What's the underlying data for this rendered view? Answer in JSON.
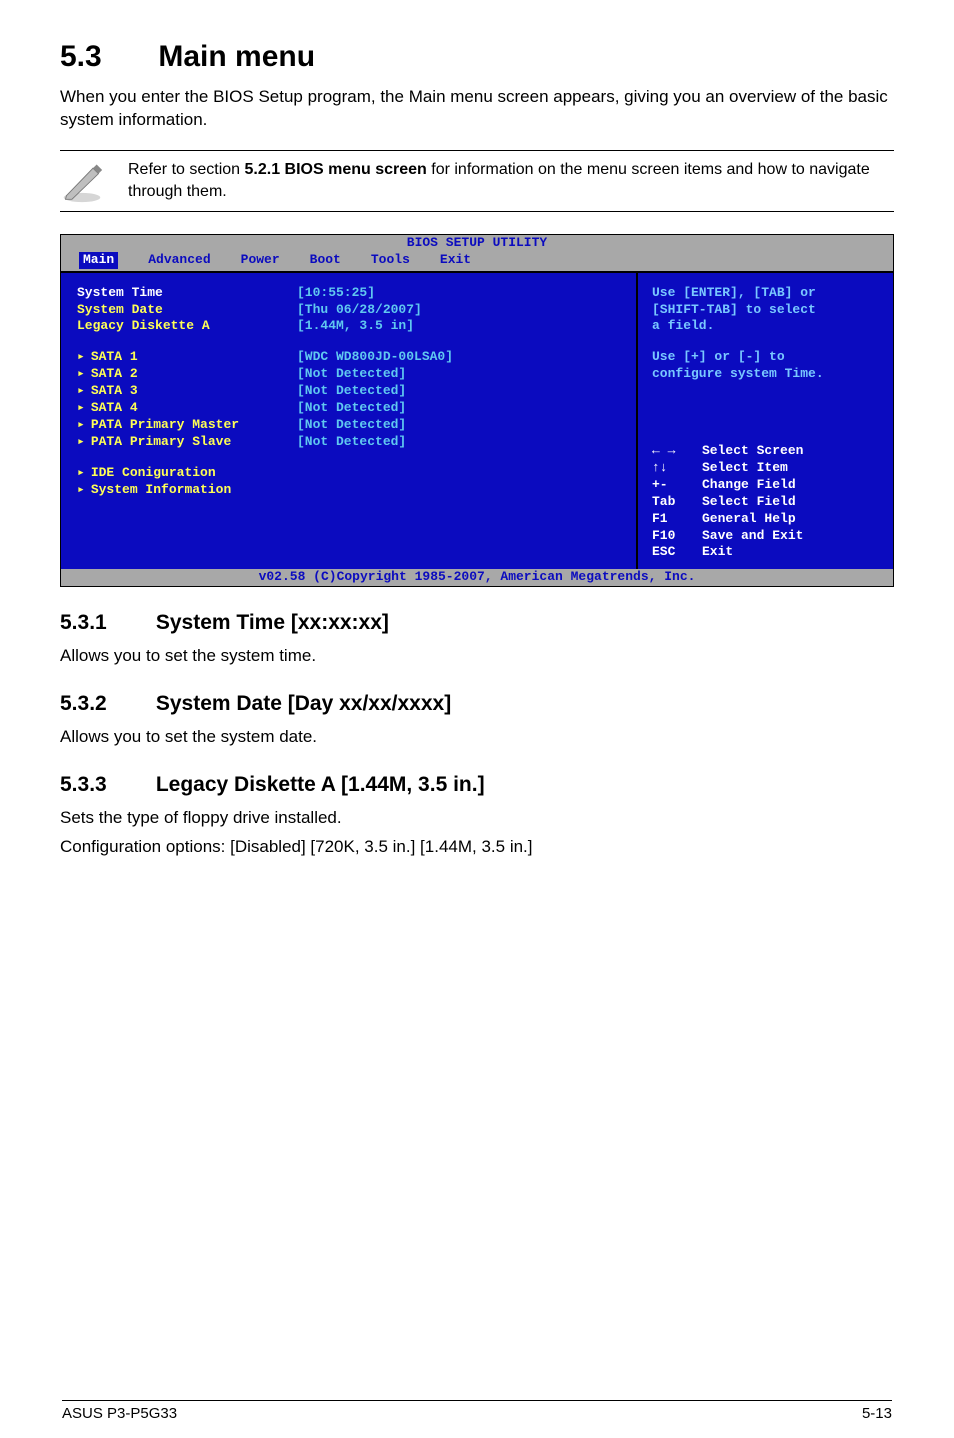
{
  "heading": {
    "num": "5.3",
    "title": "Main menu"
  },
  "intro": "When you enter the BIOS Setup program, the Main menu screen appears, giving you an overview of the basic system information.",
  "note": {
    "pre": "Refer to section ",
    "bold": "5.2.1 BIOS menu screen",
    "post": " for information on the menu screen items and how to navigate through them."
  },
  "bios": {
    "title": "BIOS SETUP UTILITY",
    "tabs": [
      "Main",
      "Advanced",
      "Power",
      "Boot",
      "Tools",
      "Exit"
    ],
    "left": {
      "rows": [
        {
          "k": "System Time",
          "v": "[10:55:25]"
        },
        {
          "k": "System Date",
          "v": "[Thu 06/28/2007]"
        },
        {
          "k": "Legacy Diskette A",
          "v": "[1.44M, 3.5 in]"
        }
      ],
      "sata": [
        {
          "k": "SATA 1",
          "v": "[WDC WD800JD-00LSA0]"
        },
        {
          "k": "SATA 2",
          "v": "[Not Detected]"
        },
        {
          "k": "SATA 3",
          "v": "[Not Detected]"
        },
        {
          "k": "SATA 4",
          "v": "[Not Detected]"
        },
        {
          "k": "PATA Primary Master",
          "v": "[Not Detected]"
        },
        {
          "k": "PATA Primary Slave",
          "v": "[Not Detected]"
        }
      ],
      "bottom": [
        "IDE Coniguration",
        "System Information"
      ]
    },
    "right": {
      "help1a": "Use [ENTER], [TAB] or",
      "help1b": "[SHIFT-TAB] to select",
      "help1c": "a field.",
      "help2a": "Use [+] or [-] to",
      "help2b": "configure system Time.",
      "keys": [
        {
          "key": "← →",
          "label": "Select Screen"
        },
        {
          "key": "↑↓",
          "label": "Select Item"
        },
        {
          "key": "+-",
          "label": "Change Field"
        },
        {
          "key": "Tab",
          "label": "Select Field"
        },
        {
          "key": "F1",
          "label": "General Help"
        },
        {
          "key": "F10",
          "label": "Save and Exit"
        },
        {
          "key": "ESC",
          "label": "Exit"
        }
      ]
    },
    "footer": "v02.58 (C)Copyright 1985-2007, American Megatrends, Inc."
  },
  "sections": [
    {
      "num": "5.3.1",
      "title": "System Time [xx:xx:xx]",
      "body": [
        "Allows you to set the system time."
      ]
    },
    {
      "num": "5.3.2",
      "title": "System Date [Day xx/xx/xxxx]",
      "body": [
        "Allows you to set the system date."
      ]
    },
    {
      "num": "5.3.3",
      "title": "Legacy Diskette A [1.44M, 3.5 in.]",
      "body": [
        "Sets the type of floppy drive installed.",
        "Configuration options: [Disabled] [720K, 3.5 in.] [1.44M, 3.5 in.]"
      ]
    }
  ],
  "footer": {
    "left": "ASUS P3-P5G33",
    "right": "5-13"
  }
}
